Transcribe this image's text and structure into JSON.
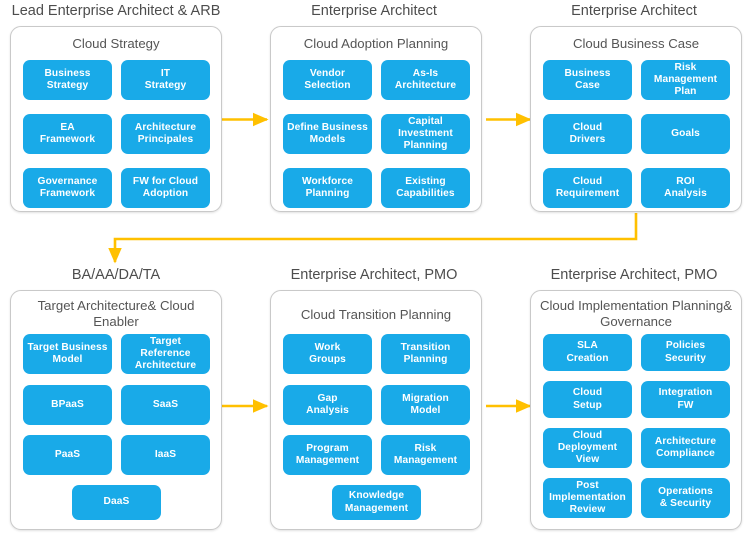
{
  "theme": {
    "chip_color": "#19AAE8",
    "arrow_color": "#FFC000",
    "card_border_color": "#C9C9C9",
    "heading_color": "#4D4D4D",
    "card_title_color": "#555555",
    "background": "#FFFFFF"
  },
  "columns": [
    {
      "heading": "Lead Enterprise Architect & ARB",
      "card_title": "Cloud Strategy",
      "items": [
        "Business\nStrategy",
        "IT\nStrategy",
        "EA\nFramework",
        "Architecture\nPrincipales",
        "Governance\nFramework",
        "FW for Cloud\nAdoption"
      ]
    },
    {
      "heading": "Enterprise Architect",
      "card_title": "Cloud Adoption Planning",
      "items": [
        "Vendor\nSelection",
        "As-Is\nArchitecture",
        "Define Business\nModels",
        "Capital\nInvestment\nPlanning",
        "Workforce\nPlanning",
        "Existing\nCapabilities"
      ]
    },
    {
      "heading": "Enterprise Architect",
      "card_title": "Cloud Business Case",
      "items": [
        "Business\nCase",
        "Risk\nManagement\nPlan",
        "Cloud\nDrivers",
        "Goals",
        "Cloud\nRequirement",
        "ROI\nAnalysis"
      ]
    },
    {
      "heading": "BA/AA/DA/TA",
      "card_title": "Target Architecture\n& Cloud Enabler",
      "items": [
        "Target Business\nModel",
        "Target\nReference\nArchitecture",
        "BPaaS",
        "SaaS",
        "PaaS",
        "IaaS",
        "DaaS"
      ]
    },
    {
      "heading": "Enterprise Architect, PMO",
      "card_title": "Cloud Transition Planning",
      "items": [
        "Work\nGroups",
        "Transition\nPlanning",
        "Gap\nAnalysis",
        "Migration\nModel",
        "Program\nManagement",
        "Risk\nManagement",
        "Knowledge\nManagement"
      ]
    },
    {
      "heading": "Enterprise Architect, PMO",
      "card_title": "Cloud Implementation Planning\n& Governance",
      "items": [
        "SLA\nCreation",
        "Policies\nSecurity",
        "Cloud\nSetup",
        "Integration\nFW",
        "Cloud\nDeployment\nView",
        "Architecture\nCompliance",
        "Post\nImplementation\nReview",
        "Operations\n& Security"
      ]
    }
  ],
  "connectors": [
    {
      "name": "arrow-strategy-to-adoption",
      "type": "horizontal"
    },
    {
      "name": "arrow-adoption-to-business-case",
      "type": "horizontal"
    },
    {
      "name": "arrow-business-case-to-target-architecture",
      "type": "elbow"
    },
    {
      "name": "arrow-target-architecture-to-transition",
      "type": "horizontal"
    },
    {
      "name": "arrow-transition-to-implementation",
      "type": "horizontal"
    }
  ]
}
